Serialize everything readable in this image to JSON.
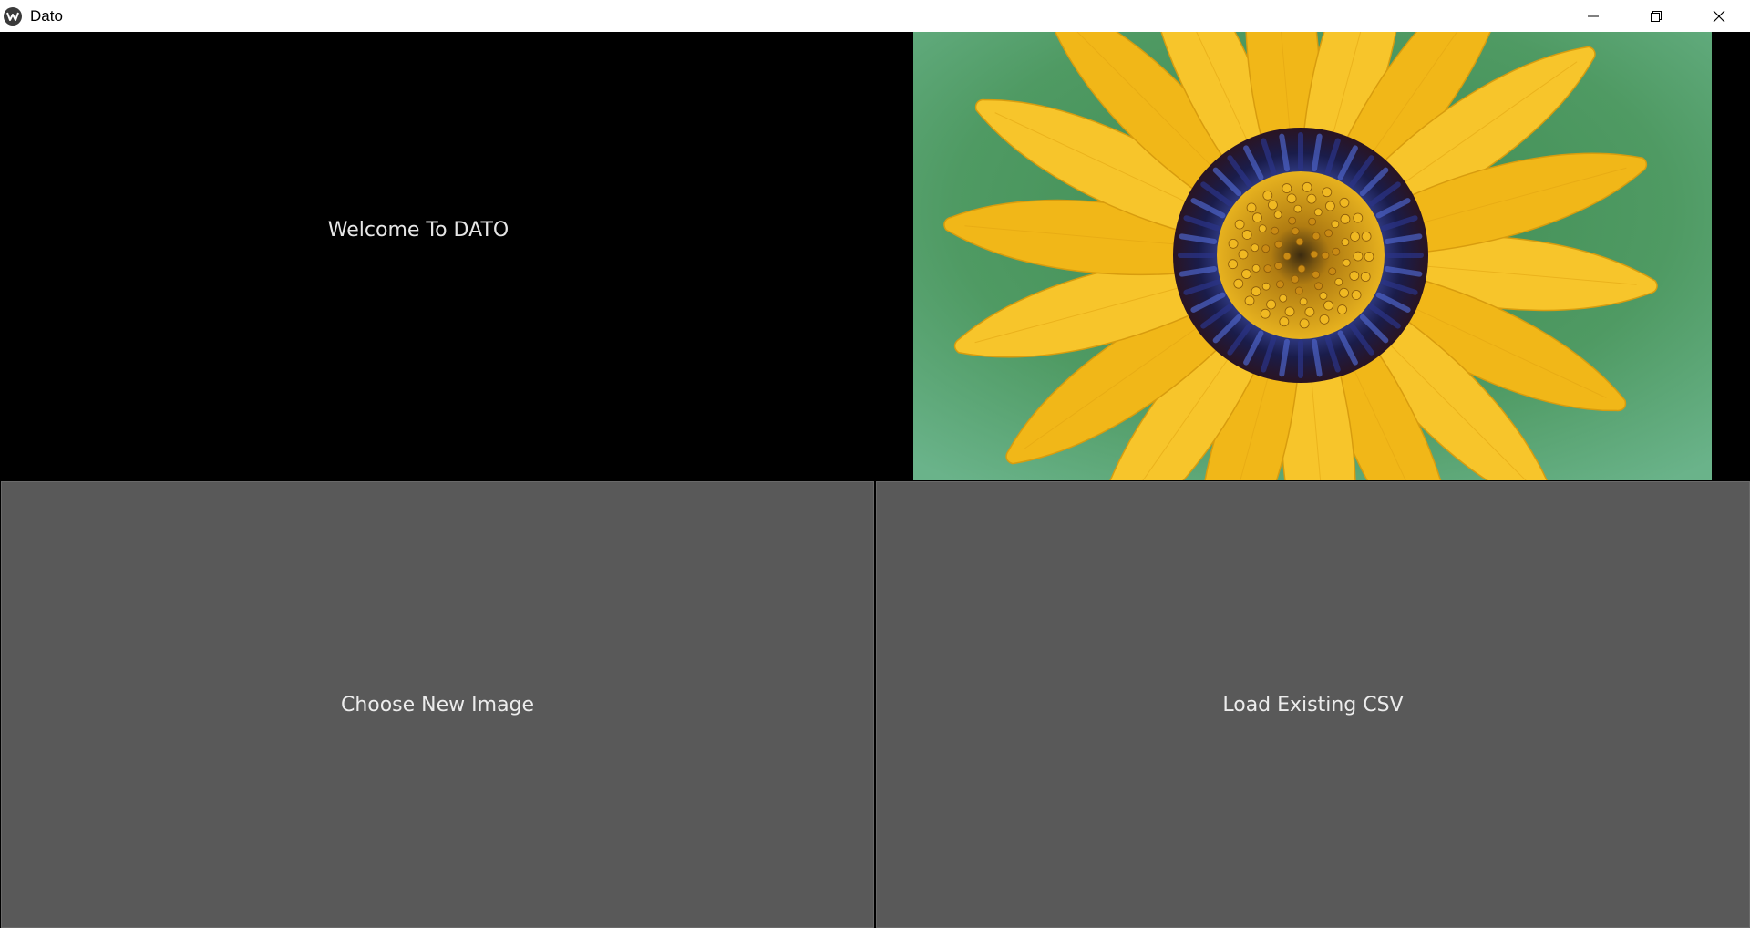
{
  "window": {
    "title": "Dato",
    "controls": [
      "minimize-icon",
      "restore-icon",
      "close-icon"
    ]
  },
  "main": {
    "welcome_text": "Welcome To DATO",
    "image": {
      "subject": "yellow daisy flower with dark blue center on green background",
      "colors": {
        "petal": "#f2b81c",
        "center_ring": "#1c1f52",
        "disc": "#d9a117",
        "background": "#4f9a63"
      }
    }
  },
  "buttons": {
    "choose_image_label": "Choose New Image",
    "load_csv_label": "Load Existing CSV"
  },
  "theme": {
    "button_bg": "#595959",
    "button_text": "#ececec",
    "window_bg": "#000000"
  }
}
